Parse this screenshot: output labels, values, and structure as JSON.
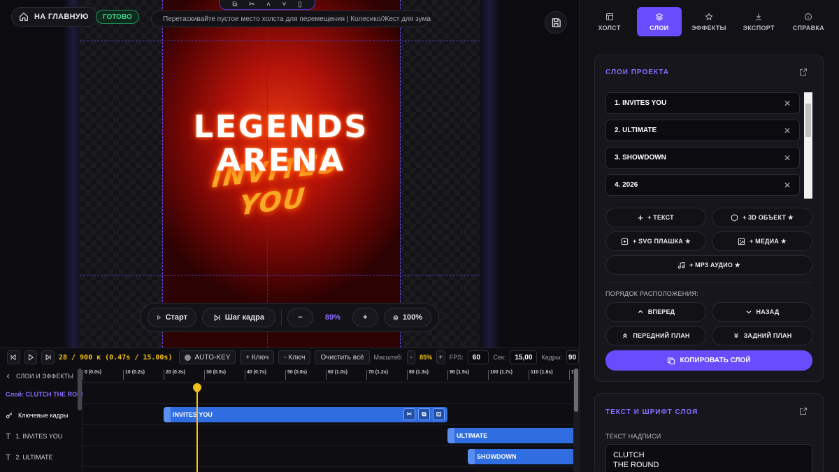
{
  "header": {
    "home_label": "НА ГЛАВНУЮ",
    "status_badge": "ГОТОВО",
    "hint": "Перетаскивайте пустое место холста для перемещения | Колесико/Жест для зума"
  },
  "canvas": {
    "title_line1": "LEGENDS",
    "title_line2": "ARENA",
    "subtitle": "INVITES YOU",
    "colors": {
      "bg_center": "#e33a12",
      "bg_edge": "#2c0202",
      "title": "#ffffff",
      "subtitle": "#f9a825",
      "guide": "#6a4cff"
    }
  },
  "playbar": {
    "start_label": "Старт",
    "step_label": "Шаг кадра",
    "minus": "−",
    "zoom": "89%",
    "plus": "+",
    "fit_label": "100%"
  },
  "timeline": {
    "frame_counter": "28 / 900 к (0.47s / 15.00s)",
    "autokey_label": "AUTO-KEY",
    "add_key_label": "+ Ключ",
    "remove_key_label": "- Ключ",
    "clear_all_label": "Очистить всё",
    "scale_label": "Масштаб:",
    "scale_minus": "-",
    "scale_value": "85%",
    "scale_plus": "+",
    "fps_label": "FPS:",
    "fps_value": "60",
    "sec_label": "Сек:",
    "sec_value": "15,00",
    "frames_label": "Кадры:",
    "frames_value": "90",
    "ruler": [
      "0 (0.0s)",
      "10 (0.2s)",
      "20 (0.3s)",
      "30 (0.5s)",
      "40 (0.7s)",
      "50 (0.8s)",
      "60 (1.0s)",
      "70 (1.2s)",
      "80 (1.3s)",
      "90 (1.5s)",
      "100 (1.7s)",
      "110 (1.8s)",
      "1"
    ],
    "left": {
      "back_label": "СЛОИ И ЭФФЕКТЫ",
      "layer_label": "Слой: CLUTCH THE ROUND",
      "keyframes_label": "Ключевые кадры",
      "row1": "1. INVITES YOU",
      "row2": "2. ULTIMATE"
    },
    "clips": {
      "c1": "INVITES YOU",
      "c2": "ULTIMATE",
      "c3": "SHOWDOWN"
    },
    "playhead_frame": 28
  },
  "panel": {
    "tabs": [
      "ХОЛСТ",
      "СЛОИ",
      "ЭФФЕКТЫ",
      "ЭКСПОРТ",
      "СПРАВКА"
    ],
    "active_tab": "СЛОИ",
    "layers_title": "СЛОИ ПРОЕКТА",
    "layers": [
      "1. INVITES YOU",
      "2. ULTIMATE",
      "3. SHOWDOWN",
      "4. 2026"
    ],
    "add_text": "+ ТЕКСТ",
    "add_3d": "+ 3D ОБЪЕКТ ★",
    "add_svg": "+ SVG ПЛАШКА ★",
    "add_media": "+ МЕДИА ★",
    "add_mp3": "+ MP3 АУДИО ★",
    "order_label": "ПОРЯДОК РАСПОЛОЖЕНИЯ:",
    "forward": "ВПЕРЕД",
    "backward": "НАЗАД",
    "front": "ПЕРЕДНИЙ ПЛАН",
    "back": "ЗАДНИЙ ПЛАН",
    "copy_layer": "КОПИРОВАТЬ СЛОЙ",
    "text_section_title": "ТЕКСТ И ШРИФТ СЛОЯ",
    "text_label": "ТЕКСТ НАДПИСИ",
    "text_value_line1": "CLUTCH",
    "text_value_line2": "THE ROUND",
    "accent": "#6a4cff"
  }
}
